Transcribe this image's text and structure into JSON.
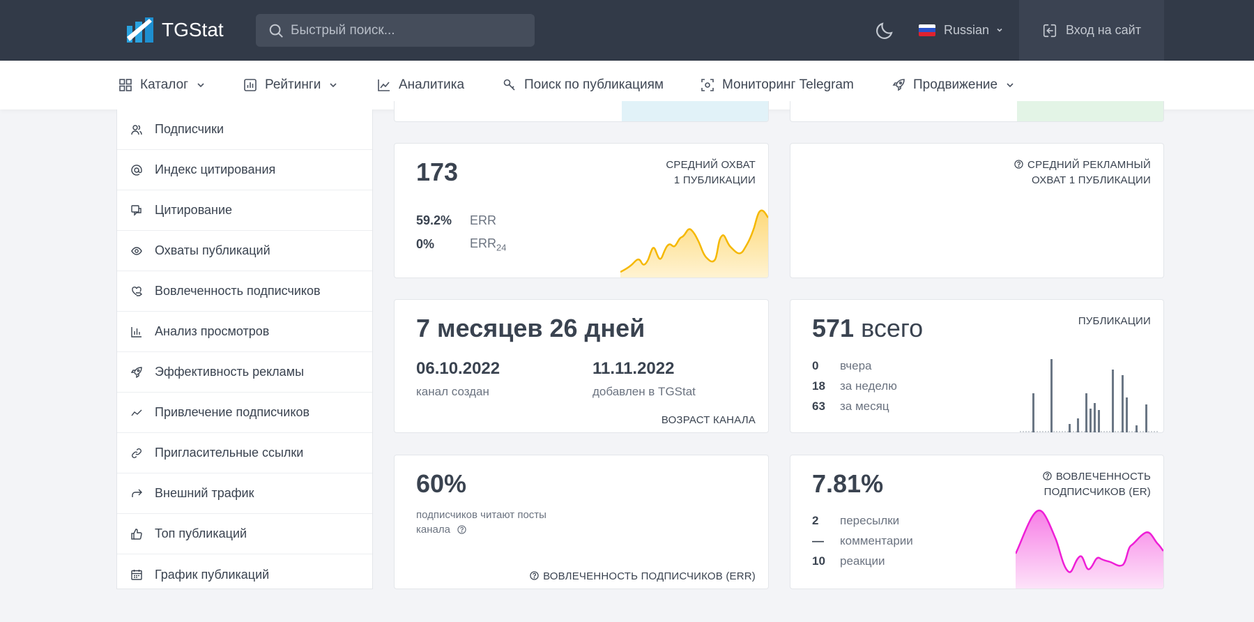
{
  "brand": {
    "name": "TGStat"
  },
  "search": {
    "placeholder": "Быстрый поиск..."
  },
  "header": {
    "language": "Russian",
    "login": "Вход на сайт"
  },
  "menu": [
    {
      "label": "Каталог",
      "icon": "grid-icon",
      "dropdown": true
    },
    {
      "label": "Рейтинги",
      "icon": "bar-chart-icon",
      "dropdown": true
    },
    {
      "label": "Аналитика",
      "icon": "line-chart-icon",
      "dropdown": false
    },
    {
      "label": "Поиск по публикациям",
      "icon": "key-icon",
      "dropdown": false
    },
    {
      "label": "Мониторинг Telegram",
      "icon": "scan-icon",
      "dropdown": false
    },
    {
      "label": "Продвижение",
      "icon": "rocket-icon",
      "dropdown": true
    }
  ],
  "sidebar": {
    "items": [
      {
        "label": "Подписчики",
        "icon": "users-icon"
      },
      {
        "label": "Индекс цитирования",
        "icon": "at-icon"
      },
      {
        "label": "Цитирование",
        "icon": "quote-icon"
      },
      {
        "label": "Охваты публикаций",
        "icon": "eye-icon"
      },
      {
        "label": "Вовлеченность подписчиков",
        "icon": "heart-hand-icon"
      },
      {
        "label": "Анализ просмотров",
        "icon": "bar-chart-icon"
      },
      {
        "label": "Эффективность рекламы",
        "icon": "rocket-icon"
      },
      {
        "label": "Привлечение подписчиков",
        "icon": "trend-icon"
      },
      {
        "label": "Пригласительные ссылки",
        "icon": "link-icon"
      },
      {
        "label": "Внешний трафик",
        "icon": "share-icon"
      },
      {
        "label": "Топ публикаций",
        "icon": "thumb-up-icon"
      },
      {
        "label": "График публикаций",
        "icon": "calendar-icon"
      }
    ]
  },
  "cards": {
    "reach": {
      "value": "173",
      "caption_line1": "СРЕДНИЙ ОХВАТ",
      "caption_line2": "1 ПУБЛИКАЦИИ",
      "err_value": "59.2%",
      "err_label": "ERR",
      "err24_value": "0%",
      "err24_label": "ERR",
      "err24_sub": "24",
      "color": "#f5b800"
    },
    "ad_reach": {
      "caption_line1": "СРЕДНИЙ РЕКЛАМНЫЙ",
      "caption_line2": "ОХВАТ 1 ПУБЛИКАЦИИ"
    },
    "age": {
      "value": "7 месяцев 26 дней",
      "created_date": "06.10.2022",
      "created_label": "канал создан",
      "added_date": "11.11.2022",
      "added_label": "добавлен в TGStat",
      "caption": "ВОЗРАСТ КАНАЛА"
    },
    "posts": {
      "total_number": "571",
      "total_word": "всего",
      "caption": "ПУБЛИКАЦИИ",
      "rows": [
        {
          "value": "0",
          "label": "вчера"
        },
        {
          "value": "18",
          "label": "за неделю"
        },
        {
          "value": "63",
          "label": "за месяц"
        }
      ],
      "bar_color": "#6b7785"
    },
    "readers": {
      "value": "60%",
      "text_line1": "подписчиков читают посты",
      "text_line2": "канала",
      "caption": "ВОВЛЕЧЕННОСТЬ ПОДПИСЧИКОВ (ERR)"
    },
    "er": {
      "value": "7.81%",
      "caption_line1": "ВОВЛЕЧЕННОСТЬ",
      "caption_line2": "ПОДПИСЧИКОВ (ER)",
      "rows": [
        {
          "value": "2",
          "label": "пересылки"
        },
        {
          "value": "—",
          "label": "комментарии"
        },
        {
          "value": "10",
          "label": "реакции"
        }
      ],
      "color": "#ee1fd6"
    }
  }
}
